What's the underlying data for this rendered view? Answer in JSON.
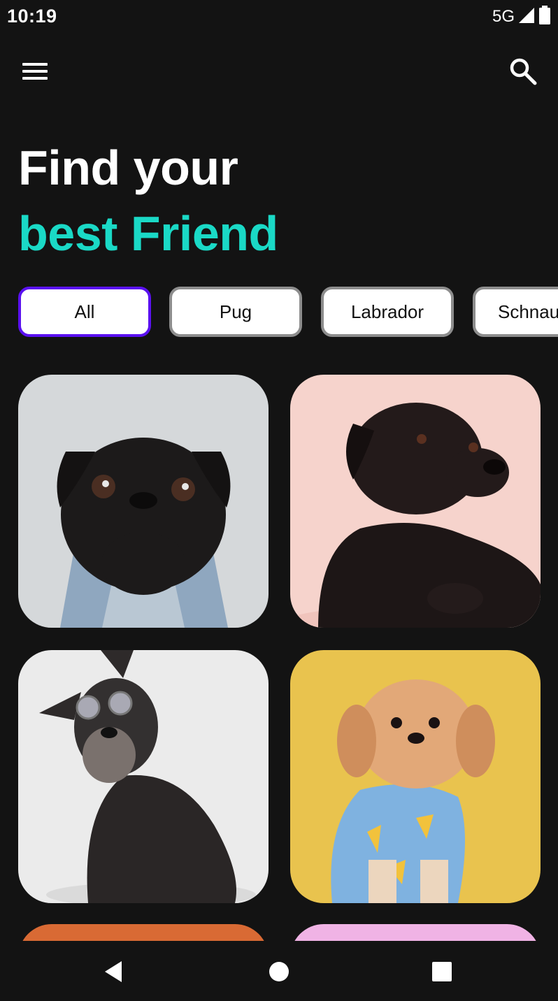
{
  "status_bar": {
    "time": "10:19",
    "network": "5G",
    "icons": [
      "signal-icon",
      "battery-icon"
    ]
  },
  "app_bar": {
    "menu_icon": "menu-icon",
    "search_icon": "search-icon"
  },
  "headline": {
    "line1": "Find your",
    "line2": "best Friend",
    "accent_color": "#1ad9c6"
  },
  "filters": {
    "selected": "All",
    "chips": [
      {
        "label": "All"
      },
      {
        "label": "Pug"
      },
      {
        "label": "Labrador"
      },
      {
        "label": "Schnau"
      }
    ],
    "selected_border_color": "#5a10f0"
  },
  "dog_cards": [
    {
      "image": "black pug in denim jacket on light gray background",
      "background": "#d5d8da"
    },
    {
      "image": "black labrador lying down on pink background",
      "background": "#f6d3cc"
    },
    {
      "image": "schnauzer wearing round sunglasses on white background",
      "background": "#ebebeb"
    },
    {
      "image": "small fluffy dog in banana pajamas on yellow background",
      "background": "#e9c34e"
    },
    {
      "image": "partially visible card",
      "background": "#d96a34"
    },
    {
      "image": "partially visible card",
      "background": "#f0b3e5"
    }
  ],
  "nav_bar": {
    "buttons": [
      "back-icon",
      "home-icon",
      "recents-icon"
    ]
  }
}
